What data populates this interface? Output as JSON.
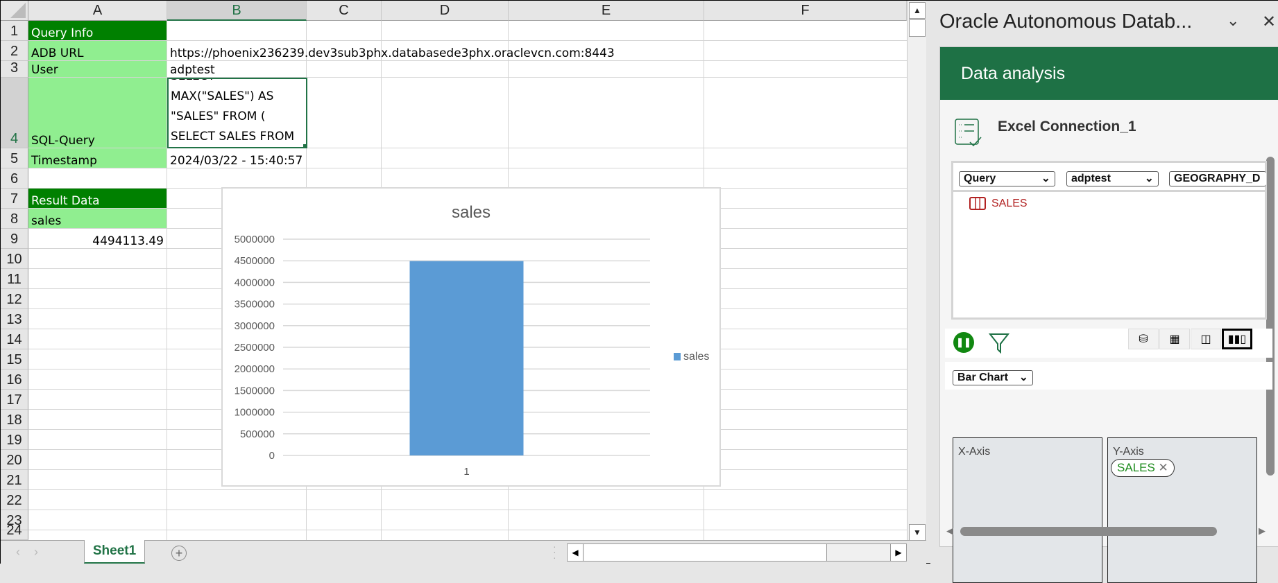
{
  "sheet": {
    "columns": [
      "A",
      "B",
      "C",
      "D",
      "E",
      "F"
    ],
    "rows": [
      "1",
      "2",
      "3",
      "4",
      "5",
      "6",
      "7",
      "8",
      "9",
      "10",
      "11",
      "12",
      "13",
      "14",
      "15",
      "16",
      "17",
      "18",
      "19",
      "20",
      "21",
      "22",
      "23",
      "24"
    ],
    "cells": {
      "A1": "Query Info",
      "A2": "ADB URL",
      "B2": "https://phoenix236239.dev3sub3phx.databasede3phx.oraclevcn.com:8443",
      "A3": "User",
      "B3": "adptest",
      "A4": "SQL-Query",
      "B4_lines": [
        "SELECT",
        "MAX(\"SALES\") AS",
        "\"SALES\" FROM (",
        "SELECT SALES FROM"
      ],
      "A5": "Timestamp",
      "B5": "2024/03/22 - 15:40:57",
      "A7": "Result Data",
      "A8": "sales",
      "A9": "4494113.49"
    },
    "tab_label": "Sheet1",
    "add_sheet_icon": "plus-circle-icon",
    "colors": {
      "header_dark_green": "#008000",
      "light_green": "#90ee90",
      "excel_green": "#217346"
    }
  },
  "chart_data": {
    "type": "bar",
    "title": "sales",
    "categories": [
      "1"
    ],
    "series": [
      {
        "name": "sales",
        "values": [
          4494113.49
        ],
        "color": "#5b9bd5"
      }
    ],
    "yticks": [
      "0",
      "500000",
      "1000000",
      "1500000",
      "2000000",
      "2500000",
      "3000000",
      "3500000",
      "4000000",
      "4500000",
      "5000000"
    ],
    "ylim": [
      0,
      5000000
    ],
    "xlabel": "",
    "ylabel": "",
    "grid": true,
    "legend": "right"
  },
  "pane": {
    "title": "Oracle Autonomous Datab...",
    "banner": "Data analysis",
    "connection": "Excel Connection_1",
    "selects": {
      "mode": "Query",
      "schema": "adptest",
      "object": "GEOGRAPHY_D"
    },
    "tree_item": "SALES",
    "chart_type": "Bar Chart",
    "x_axis_label": "X-Axis",
    "y_axis_label": "Y-Axis",
    "y_chip": "SALES"
  }
}
